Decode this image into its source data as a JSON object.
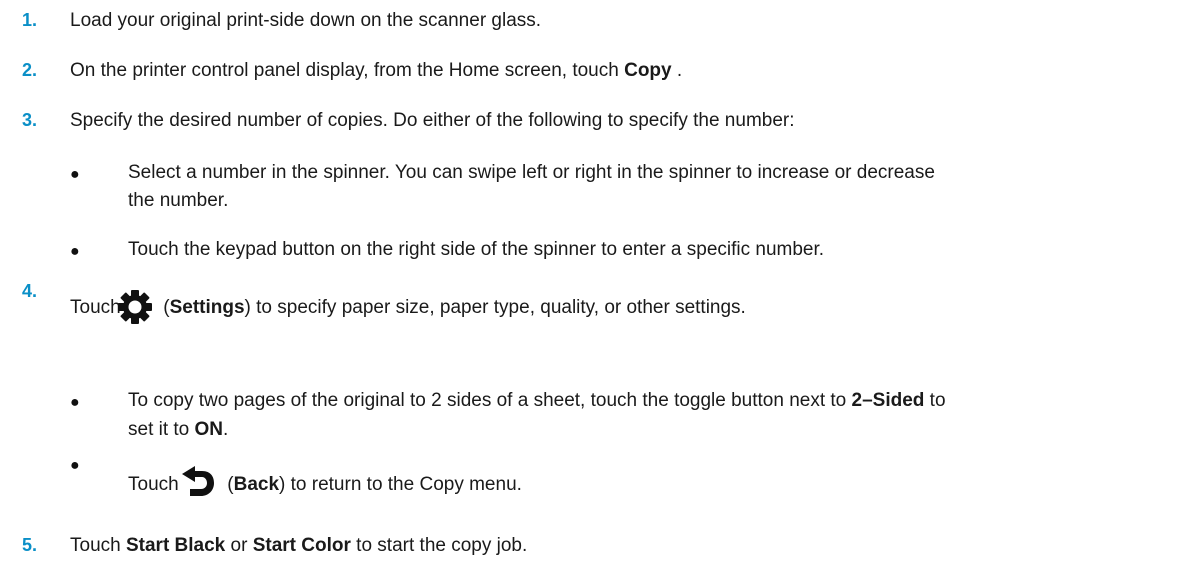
{
  "steps": [
    {
      "number": "1.",
      "text": "Load your original print-side down on the scanner glass."
    },
    {
      "number": "2.",
      "text_before": "On the printer control panel display, from the Home screen, touch ",
      "bold": "Copy",
      "text_after": " ."
    },
    {
      "number": "3.",
      "text": "Specify the desired number of copies. Do either of the following to specify the number:",
      "bullets": [
        {
          "line1": "Select a number in the spinner. You can swipe left or right in the spinner to increase or decrease",
          "line2": "the number."
        },
        {
          "text": "Touch the keypad button on the right side of the spinner to enter a specific number."
        }
      ]
    },
    {
      "number": "4.",
      "text_before": "Touch ",
      "icon": "gear-icon",
      "paren_open": " (",
      "bold": "Settings",
      "text_after": ") to specify paper size, paper type, quality, or other settings.",
      "bullets": [
        {
          "line1_before": "To copy two pages of the original to 2 sides of a sheet, touch the toggle button next to ",
          "line1_bold": "2–Sided",
          "line1_after": " to",
          "line2_before": "set it to ",
          "line2_bold": "ON",
          "line2_after": "."
        },
        {
          "text_before": "Touch ",
          "icon": "back-arrow-icon",
          "paren_open": " (",
          "bold": "Back",
          "text_after": ") to return to the Copy menu."
        }
      ]
    },
    {
      "number": "5.",
      "text_before": "Touch ",
      "bold1": "Start Black",
      "mid": " or ",
      "bold2": "Start Color",
      "text_after": " to start the copy job."
    }
  ],
  "bullet_char": "●",
  "colors": {
    "step_number": "#0a8fc7",
    "text": "#1a1a1a"
  }
}
